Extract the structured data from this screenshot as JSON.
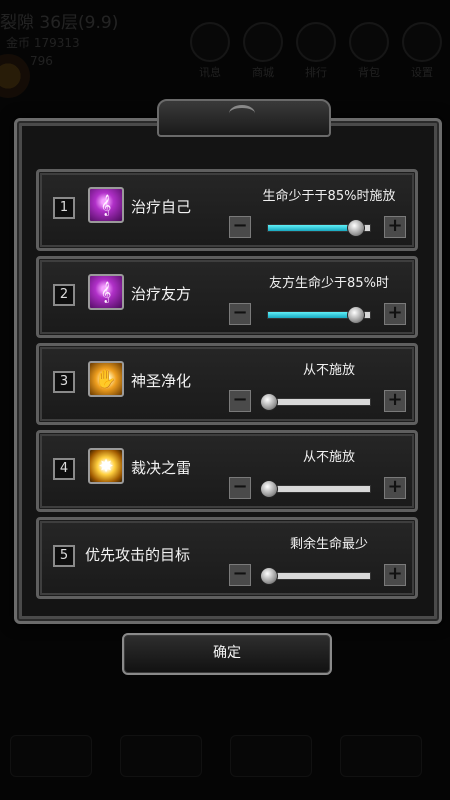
{
  "background_hud": {
    "title": "裂隙 36层(9.9)",
    "stat_line": "金币 179313",
    "stat_line2": "796",
    "buttons": [
      "讯息",
      "商城",
      "排行",
      "背包",
      "设置"
    ]
  },
  "dialog": {
    "rows": [
      {
        "index": "1",
        "icon": "heal-self-icon",
        "name": "治疗自己",
        "condition": "生命少于于85%时施放",
        "level": 0.85
      },
      {
        "index": "2",
        "icon": "heal-ally-icon",
        "name": "治疗友方",
        "condition": "友方生命少于85%时",
        "level": 0.85
      },
      {
        "index": "3",
        "icon": "holy-purify-icon",
        "name": "神圣净化",
        "condition": "从不施放",
        "level": 0
      },
      {
        "index": "4",
        "icon": "judgment-thunder-icon",
        "name": "裁决之雷",
        "condition": "从不施放",
        "level": 0
      },
      {
        "index": "5",
        "icon": "",
        "name": "优先攻击的目标",
        "condition": "剩余生命最少",
        "level": 0
      }
    ],
    "minus_label": "−",
    "plus_label": "+",
    "confirm_label": "确定"
  },
  "colors": {
    "slider_fill": "#3fd6e6",
    "frame": "#6b6b6b"
  }
}
